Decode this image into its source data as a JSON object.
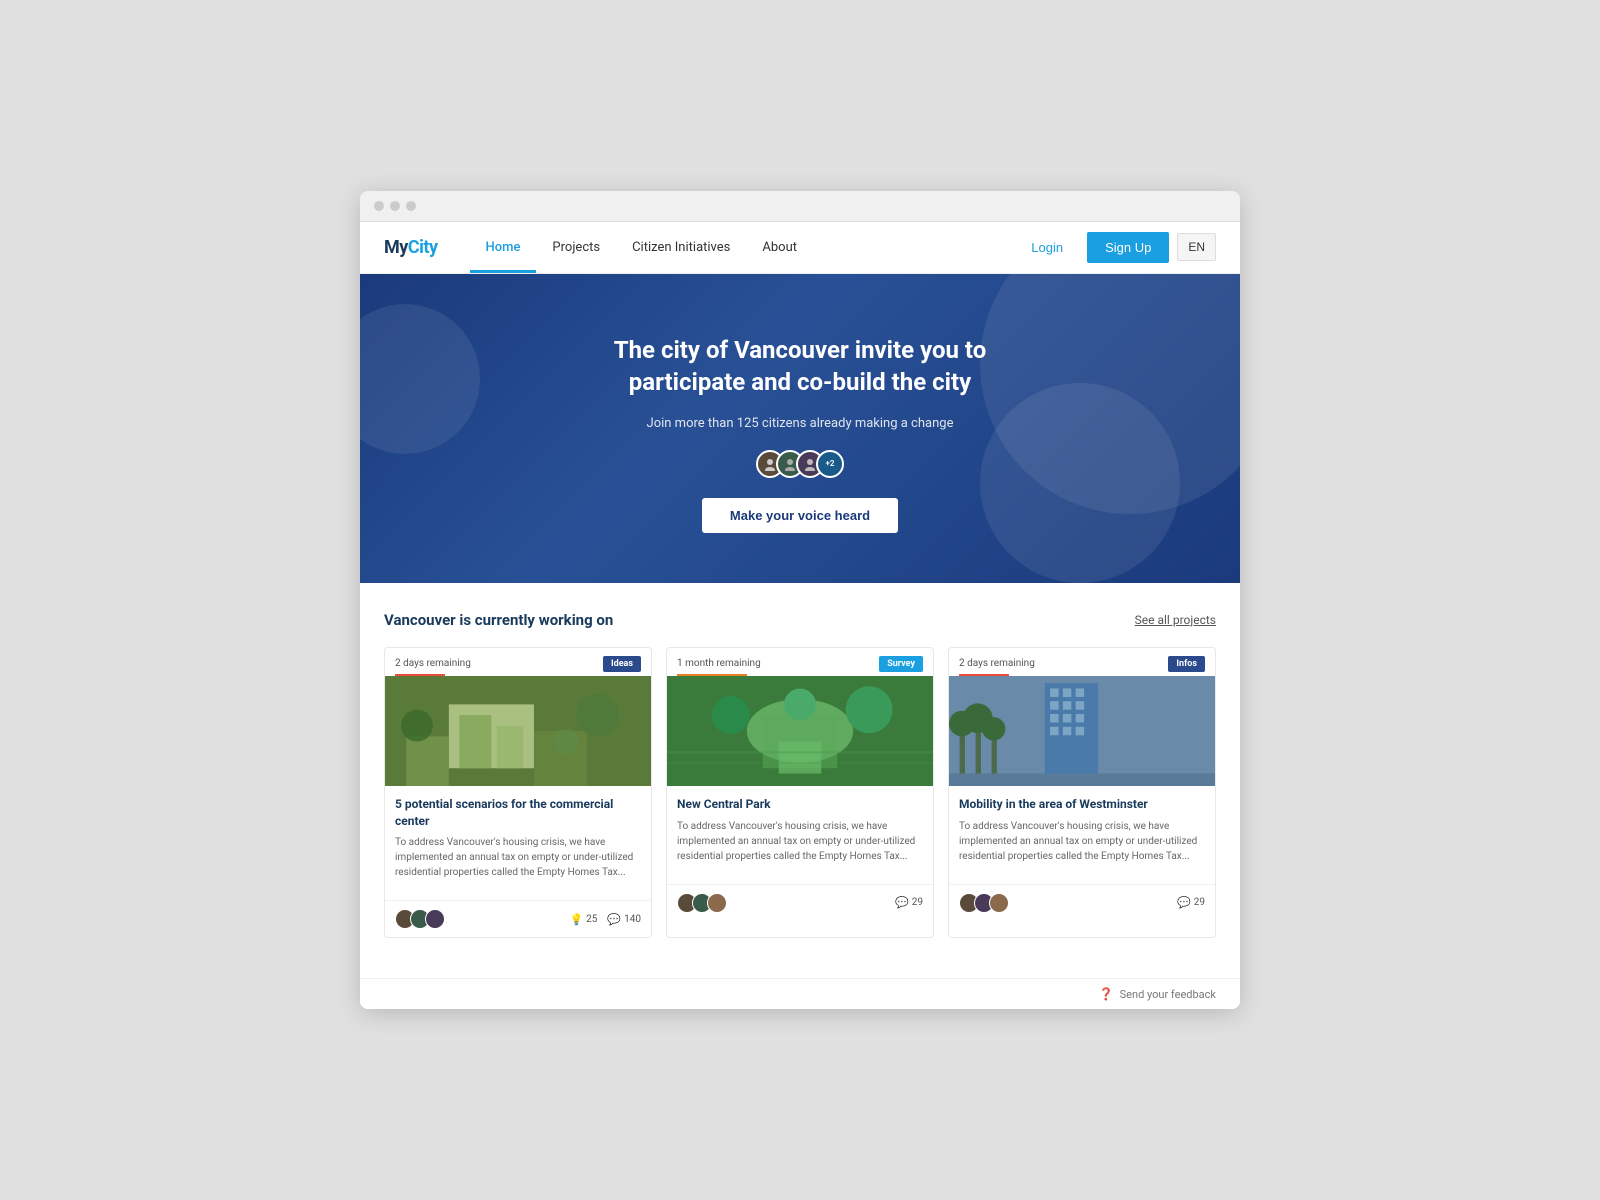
{
  "browser": {
    "dots": [
      "dot1",
      "dot2",
      "dot3"
    ]
  },
  "nav": {
    "logo": "MyCity",
    "links": [
      {
        "id": "home",
        "label": "Home",
        "active": true
      },
      {
        "id": "projects",
        "label": "Projects",
        "active": false
      },
      {
        "id": "citizen-initiatives",
        "label": "Citizen Initiatives",
        "active": false
      },
      {
        "id": "about",
        "label": "About",
        "active": false
      }
    ],
    "login_label": "Login",
    "signup_label": "Sign Up",
    "lang_label": "EN"
  },
  "hero": {
    "title": "The city of Vancouver invite you to participate and co-build the city",
    "subtitle": "Join more than 125 citizens already making a change",
    "cta_label": "Make your voice heard",
    "avatars": [
      {
        "id": "a1",
        "initials": ""
      },
      {
        "id": "a2",
        "initials": ""
      },
      {
        "id": "a3",
        "initials": ""
      },
      {
        "id": "a4",
        "initials": "+2"
      }
    ]
  },
  "projects": {
    "section_title": "Vancouver is currently working on",
    "see_all_label": "See all projects",
    "cards": [
      {
        "id": "card1",
        "timer": "2 days remaining",
        "badge": "Ideas",
        "badge_type": "ideas",
        "title": "5 potential scenarios for the commercial center",
        "description": "To address Vancouver's housing crisis, we have implemented an annual tax on empty or under-utilized residential properties called the Empty Homes Tax...",
        "img_class": "img1",
        "stats": [
          {
            "icon": "💡",
            "count": "25"
          },
          {
            "icon": "💬",
            "count": "140"
          }
        ]
      },
      {
        "id": "card2",
        "timer": "1 month remaining",
        "badge": "Survey",
        "badge_type": "survey",
        "title": "New Central Park",
        "description": "To address Vancouver's housing crisis, we have implemented an annual tax on empty or under-utilized residential properties called the Empty Homes Tax...",
        "img_class": "img2",
        "stats": [
          {
            "icon": "💬",
            "count": "29"
          }
        ]
      },
      {
        "id": "card3",
        "timer": "2 days remaining",
        "badge": "Infos",
        "badge_type": "infos",
        "title": "Mobility in the area of Westminster",
        "description": "To address Vancouver's housing crisis, we have implemented an annual tax on empty or under-utilized residential properties called the Empty Homes Tax...",
        "img_class": "img3",
        "stats": [
          {
            "icon": "💬",
            "count": "29"
          }
        ]
      }
    ]
  },
  "feedback": {
    "label": "Send your feedback"
  }
}
